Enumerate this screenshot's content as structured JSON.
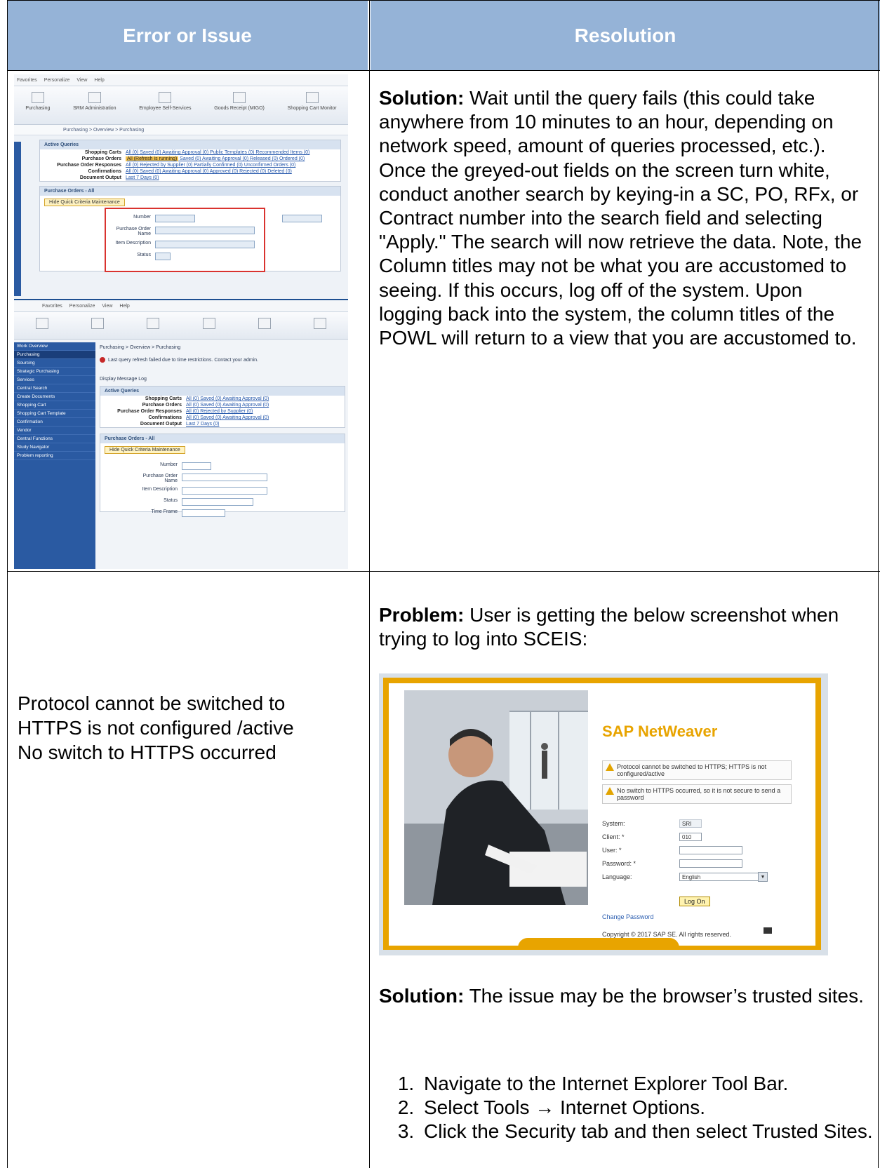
{
  "table": {
    "headers": {
      "issue": "Error or Issue",
      "resolution": "Resolution"
    },
    "rows": [
      {
        "resolution": {
          "label": "Solution:",
          "text": " Wait until the query fails (this could take anywhere from 10 minutes to an hour, depending on network speed, amount of queries processed, etc.). Once the greyed-out fields on the screen turn white, conduct another search by keying-in a SC, PO, RFx, or Contract number into the search field and selecting \"Apply.\"  The search will now retrieve the data. Note, the Column titles may not be what you are accustomed to seeing.  If this occurs, log off of the system.  Upon logging back into the system, the column titles of the POWL will return to a view that you are accustomed to."
        }
      },
      {
        "issue_lines": [
          "Protocol cannot be switched to",
          "HTTPS is not configured /active",
          "No switch to HTTPS occurred"
        ],
        "problem": {
          "label": "Problem:",
          "text": " User is getting the below screenshot when trying to log into SCEIS:"
        },
        "solution": {
          "label": "Solution:",
          "text": " The issue may be the browser’s trusted sites."
        },
        "steps": [
          "Navigate to the Internet Explorer Tool Bar.",
          "Select Tools → Internet Options.",
          "Click the Security tab and then select Trusted Sites."
        ]
      }
    ]
  },
  "sap_screenshot": {
    "menu": [
      "Favorites",
      "Personalize",
      "View",
      "Help"
    ],
    "icons": [
      "Purchasing",
      "SRM Administration",
      "Employee Self-Services",
      "Goods Receipt (MIGO)",
      "Shopping Cart Monitor"
    ],
    "breadcrumb": "Purchasing > Overview > Purchasing",
    "active_queries_title": "Active Queries",
    "queries": [
      {
        "label": "Shopping Carts",
        "links": "All (0)  Saved (0)  Awaiting Approval (0)  Public Templates (0)  Recommended Items (0)"
      },
      {
        "label": "Purchase Orders",
        "highlight": "All (Refresh is running)",
        "links": "  Saved (0)  Awaiting Approval (0)  Released (0)  Ordered (0)"
      },
      {
        "label": "Purchase Order Responses",
        "links": "All (0)  Rejected by Supplier (0)  Partially Confirmed (0)  Unconfirmed Orders (0)"
      },
      {
        "label": "Confirmations",
        "links": "All (0)  Saved (0)  Awaiting Approval (0)  Approved (0)  Rejected (0)  Deleted (0)"
      },
      {
        "label": "Document Output",
        "links": "Last 7 Days (0)"
      }
    ],
    "po_title": "Purchase Orders - All",
    "hide_button": "Hide Quick Criteria Maintenance",
    "form_fields": [
      "Number",
      "Purchase Order Name",
      "Item Description",
      "Status",
      "Time Frame"
    ],
    "nav_items": [
      "Work Overview",
      "Purchasing",
      "Sourcing",
      "Strategic Purchasing",
      "Services",
      "Central Search",
      "Create Documents",
      "Shopping Cart",
      "Shopping Cart Template",
      "Confirmation",
      "Vendor",
      "Central Functions",
      "Study Navigator",
      "Problem reporting"
    ],
    "notice": "Last query refresh failed due to time restrictions. Contact your admin.",
    "display_log": "Display Message Log"
  },
  "logon_screenshot": {
    "brand": "SAP NetWeaver",
    "warnings": [
      "Protocol cannot be switched to HTTPS; HTTPS is not configured/active",
      "No switch to HTTPS occurred, so it is not secure to send a password"
    ],
    "fields": [
      {
        "label": "System:",
        "value": "SRI"
      },
      {
        "label": "Client: *",
        "value": "010"
      },
      {
        "label": "User: *",
        "value": ""
      },
      {
        "label": "Password: *",
        "value": ""
      },
      {
        "label": "Language:",
        "value": "English"
      }
    ],
    "logon_button": "Log On",
    "change_password": "Change Password",
    "copyright": "Copyright © 2017 SAP SE. All rights reserved."
  }
}
